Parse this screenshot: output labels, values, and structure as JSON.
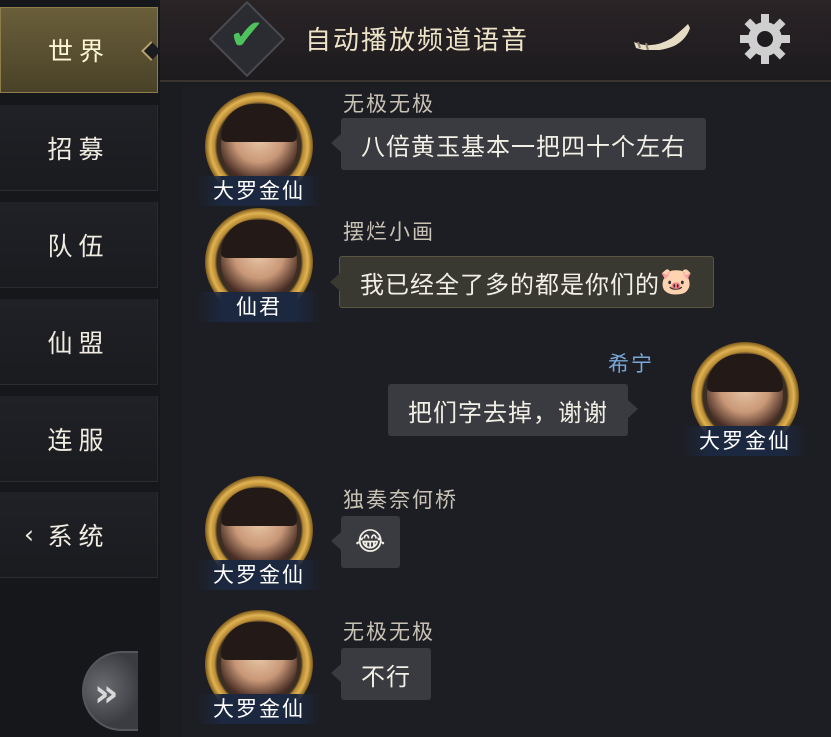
{
  "sidebar": {
    "tabs": [
      {
        "label": "世界",
        "active": true
      },
      {
        "label": "招募"
      },
      {
        "label": "队伍"
      },
      {
        "label": "仙盟"
      },
      {
        "label": "连服"
      },
      {
        "label": "系统"
      }
    ]
  },
  "header": {
    "auto_play_label": "自动播放频道语音",
    "auto_play_checked": true
  },
  "messages": [
    {
      "sender": "无极无极",
      "rank": "大罗金仙",
      "text": "八倍黄玉基本一把四十个左右",
      "side": "left"
    },
    {
      "sender": "摆烂小画",
      "rank": "仙君",
      "text": "我已经全了多的都是你们的",
      "emoji": "🐷",
      "side": "left"
    },
    {
      "sender": "希宁",
      "rank": "大罗金仙",
      "text": "把们字去掉，谢谢",
      "side": "right"
    },
    {
      "sender": "独奏奈何桥",
      "rank": "大罗金仙",
      "text": "",
      "emoji": "😂",
      "side": "left"
    },
    {
      "sender": "无极无极",
      "rank": "大罗金仙",
      "text": "不行",
      "side": "left"
    }
  ],
  "colors": {
    "accent_gold": "#b8a470",
    "check_green": "#4ec25c",
    "self_name": "#79a8d8"
  }
}
